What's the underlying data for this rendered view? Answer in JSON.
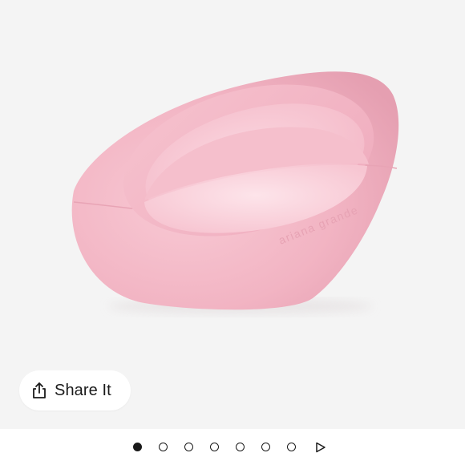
{
  "product": {
    "image_alt": "ariana grande",
    "engraving": "ariana grande"
  },
  "share": {
    "label": "Share It",
    "icon": "share-icon"
  },
  "carousel": {
    "total_slides": 7,
    "current_slide": 1,
    "next_icon": "play-triangle-icon"
  },
  "colors": {
    "background": "#f4f4f4",
    "bottle_pink": "#f2b8c6",
    "text": "#1a1a1a"
  }
}
